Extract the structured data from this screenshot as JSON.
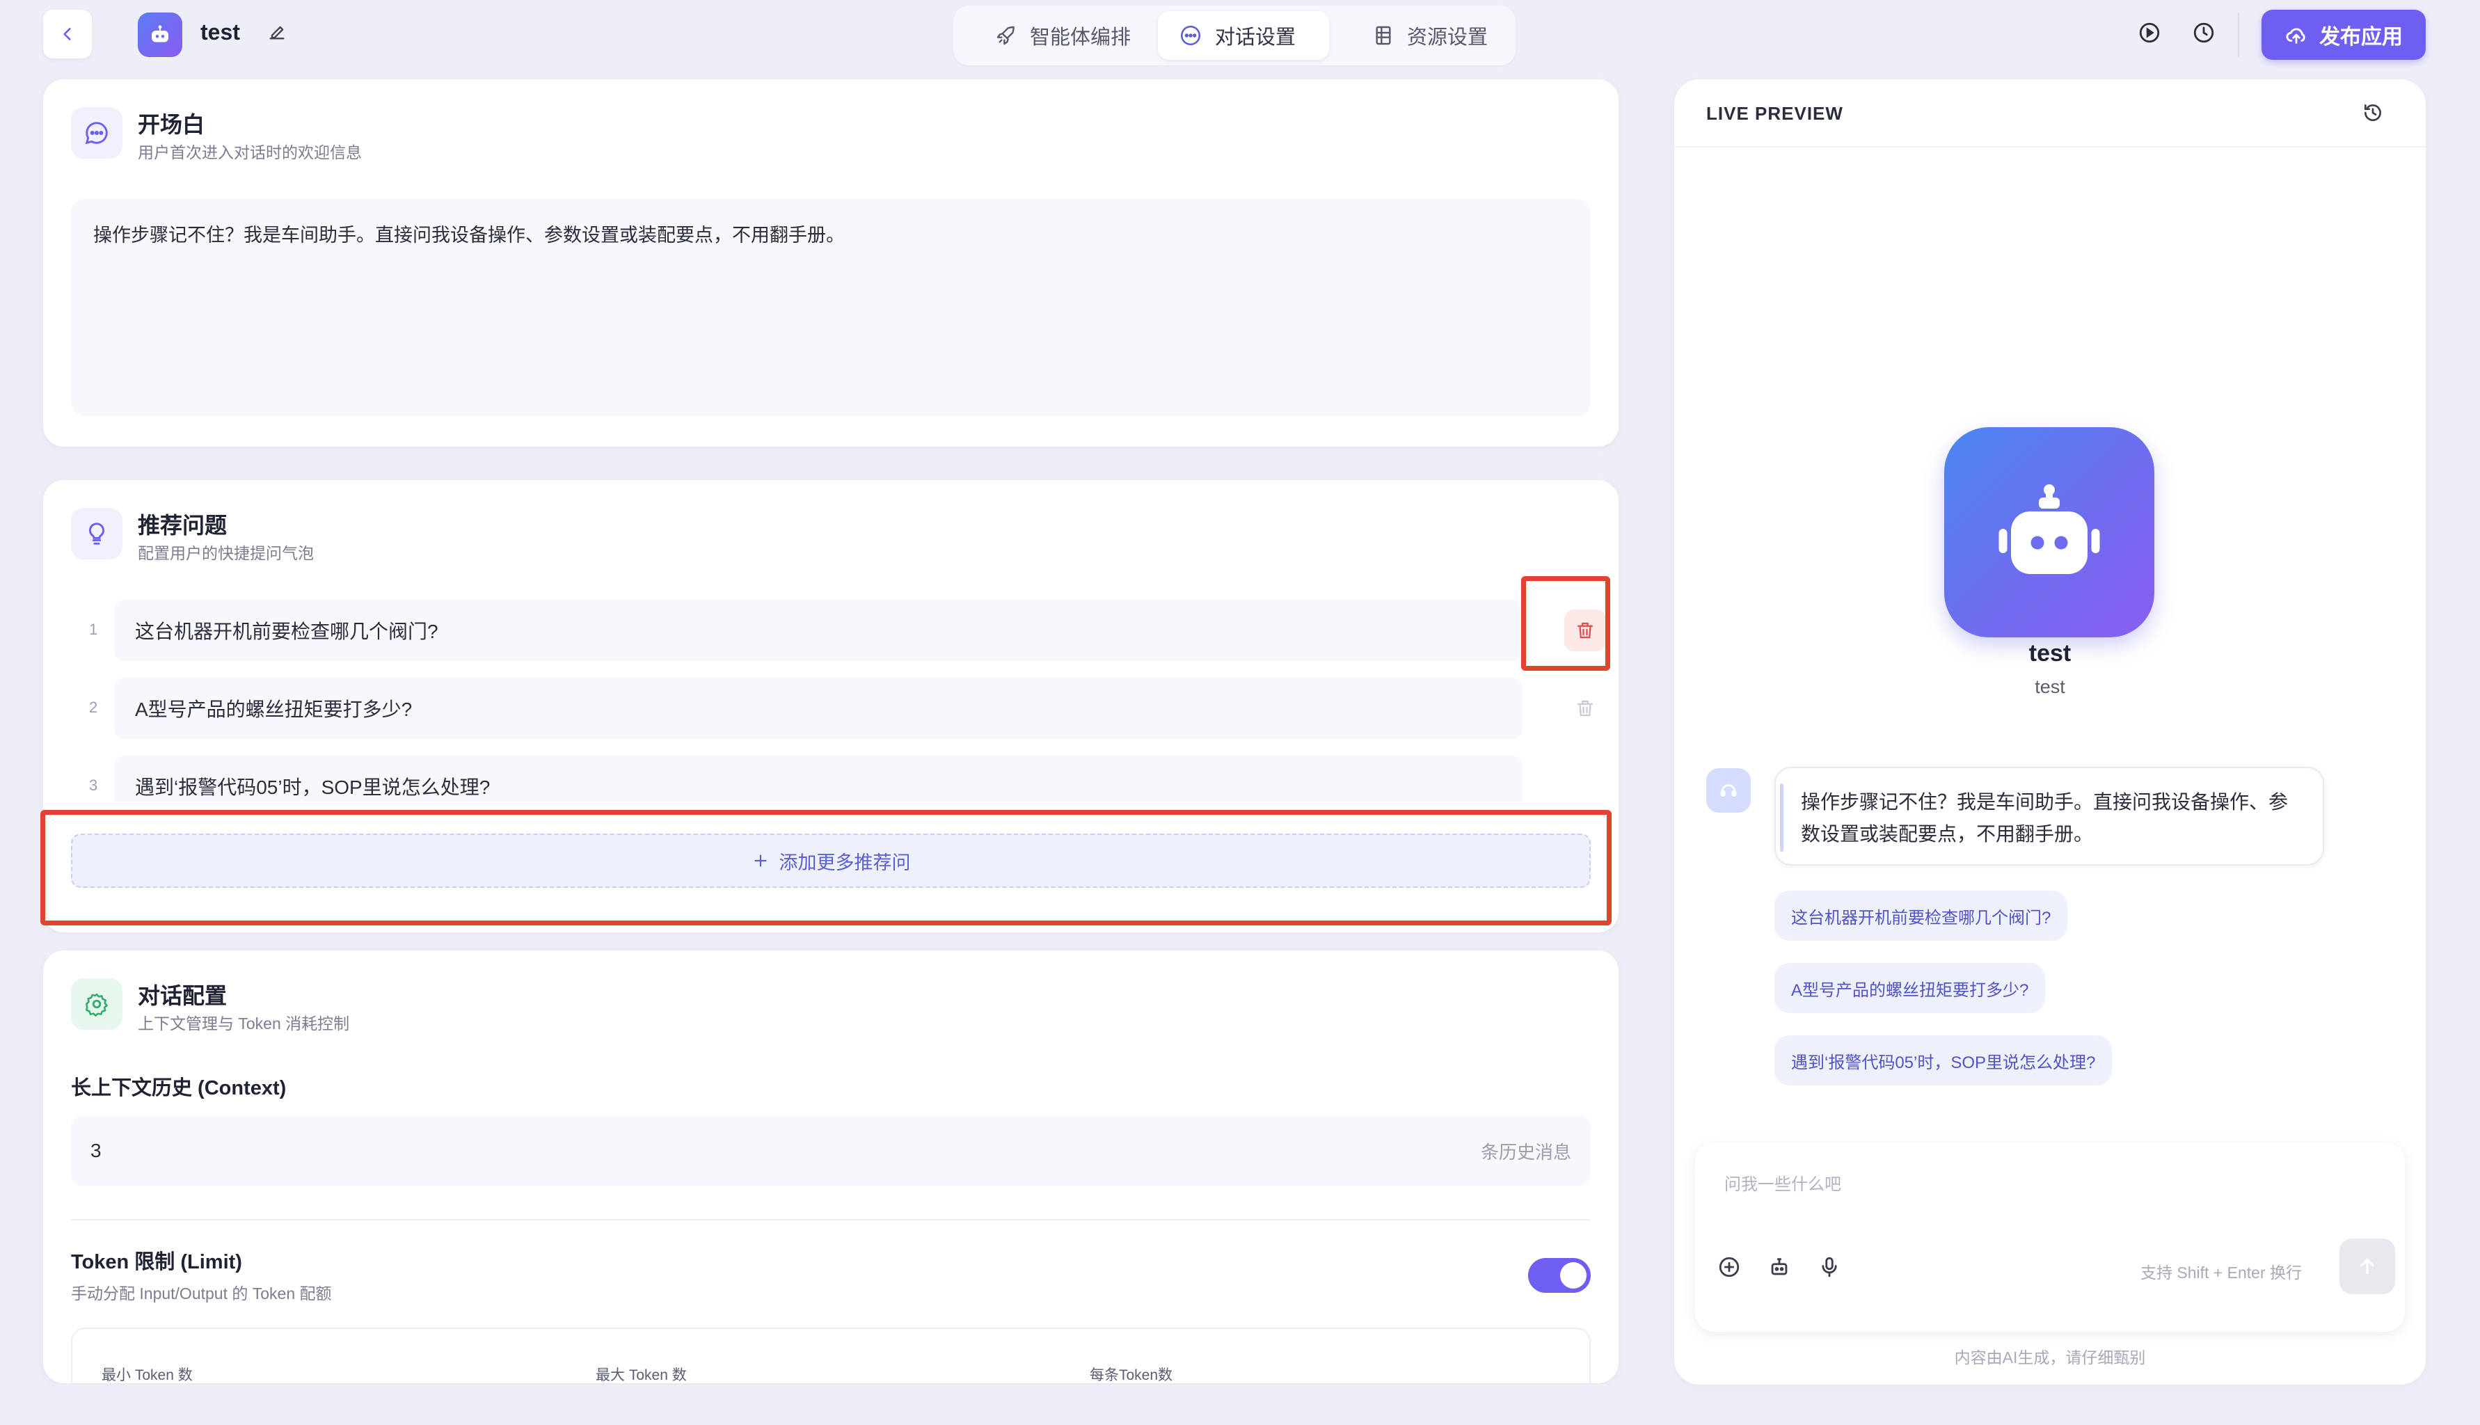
{
  "header": {
    "app_name": "test",
    "tabs": [
      {
        "label": "智能体编排",
        "active": false
      },
      {
        "label": "对话设置",
        "active": true
      },
      {
        "label": "资源设置",
        "active": false
      }
    ],
    "publish_label": "发布应用"
  },
  "opening": {
    "title": "开场白",
    "subtitle": "用户首次进入对话时的欢迎信息",
    "content": "操作步骤记不住？我是车间助手。直接问我设备操作、参数设置或装配要点，不用翻手册。"
  },
  "suggested": {
    "title": "推荐问题",
    "subtitle": "配置用户的快捷提问气泡",
    "items": [
      {
        "num": "1",
        "text": "这台机器开机前要检查哪几个阀门?"
      },
      {
        "num": "2",
        "text": "A型号产品的螺丝扭矩要打多少?"
      },
      {
        "num": "3",
        "text": "遇到‘报警代码05’时，SOP里说怎么处理?"
      }
    ],
    "add_label": "添加更多推荐问"
  },
  "dialog_config": {
    "title": "对话配置",
    "subtitle": "上下文管理与 Token 消耗控制",
    "context_label": "长上下文历史 (Context)",
    "context_value": "3",
    "context_unit": "条历史消息",
    "token_label": "Token 限制 (Limit)",
    "token_desc": "手动分配 Input/Output 的 Token 配额",
    "token_enabled": true,
    "token_columns": [
      "最小 Token 数",
      "最大 Token 数",
      "每条Token数"
    ]
  },
  "preview": {
    "title": "LIVE PREVIEW",
    "bot_name": "test",
    "bot_desc": "test",
    "message": "操作步骤记不住？我是车间助手。直接问我设备操作、参数设置或装配要点，不用翻手册。",
    "chips": [
      "这台机器开机前要检查哪几个阀门?",
      "A型号产品的螺丝扭矩要打多少?",
      "遇到‘报警代码05’时，SOP里说怎么处理?"
    ],
    "input_placeholder": "问我一些什么吧",
    "hint": "支持 Shift + Enter 换行",
    "disclaimer": "内容由AI生成，请仔细甄别"
  },
  "colors": {
    "accent": "#6f5ef2",
    "danger": "#e24b4b",
    "highlight": "#e2432f"
  }
}
